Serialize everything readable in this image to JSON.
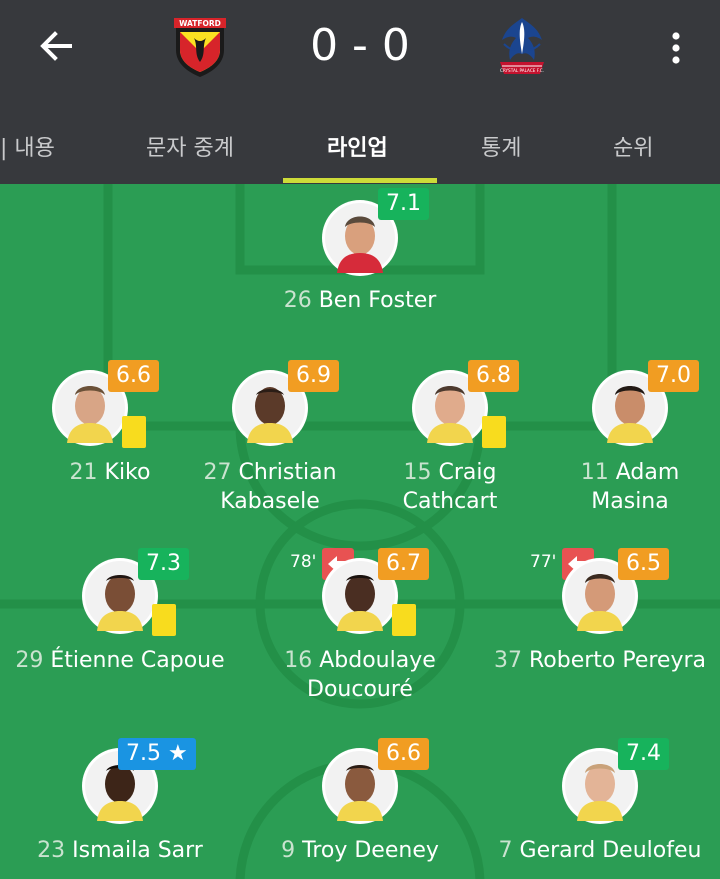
{
  "match": {
    "score": "0 - 0",
    "home_team": "Watford",
    "away_team": "Crystal Palace",
    "home_badge_text": "WATFORD",
    "away_badge_text": "CRYSTAL PALACE F.C."
  },
  "icons": {
    "back": "arrow-left-icon",
    "more": "more-vertical-icon"
  },
  "tabs": [
    {
      "label": "| 내용"
    },
    {
      "label": "문자 중계"
    },
    {
      "label": "라인업",
      "active": true
    },
    {
      "label": "통계"
    },
    {
      "label": "순위"
    }
  ],
  "colors": {
    "header_bg": "#37393d",
    "pitch": "#2b9d54",
    "accent": "#cddc39",
    "rating_green": "#17b35c",
    "rating_orange": "#f19d22",
    "rating_blue": "#1a94e2",
    "yellow_card": "#f8dc1e",
    "sub_red": "#e85252"
  },
  "players": [
    {
      "number": "26",
      "name": "Ben Foster",
      "name2": "",
      "rating": "7.1",
      "rating_color": "green",
      "yellow": false,
      "sub_minute": ""
    },
    {
      "number": "21",
      "name": "Kiko",
      "name2": "",
      "rating": "6.6",
      "rating_color": "orange",
      "yellow": true,
      "sub_minute": ""
    },
    {
      "number": "27",
      "name": "Christian",
      "name2": "Kabasele",
      "rating": "6.9",
      "rating_color": "orange",
      "yellow": false,
      "sub_minute": ""
    },
    {
      "number": "15",
      "name": "Craig",
      "name2": "Cathcart",
      "rating": "6.8",
      "rating_color": "orange",
      "yellow": true,
      "sub_minute": ""
    },
    {
      "number": "11",
      "name": "Adam",
      "name2": "Masina",
      "rating": "7.0",
      "rating_color": "orange",
      "yellow": false,
      "sub_minute": ""
    },
    {
      "number": "29",
      "name": "Étienne Capoue",
      "name2": "",
      "rating": "7.3",
      "rating_color": "green",
      "yellow": true,
      "sub_minute": ""
    },
    {
      "number": "16",
      "name": "Abdoulaye",
      "name2": "Doucouré",
      "rating": "6.7",
      "rating_color": "orange",
      "yellow": true,
      "sub_minute": "78'"
    },
    {
      "number": "37",
      "name": "Roberto Pereyra",
      "name2": "",
      "rating": "6.5",
      "rating_color": "orange",
      "yellow": false,
      "sub_minute": "77'"
    },
    {
      "number": "23",
      "name": "Ismaila Sarr",
      "name2": "",
      "rating": "7.5 ★",
      "rating_color": "blue",
      "yellow": false,
      "sub_minute": ""
    },
    {
      "number": "9",
      "name": "Troy Deeney",
      "name2": "",
      "rating": "6.6",
      "rating_color": "orange",
      "yellow": false,
      "sub_minute": ""
    },
    {
      "number": "7",
      "name": "Gerard Deulofeu",
      "name2": "",
      "rating": "7.4",
      "rating_color": "green",
      "yellow": false,
      "sub_minute": ""
    }
  ]
}
